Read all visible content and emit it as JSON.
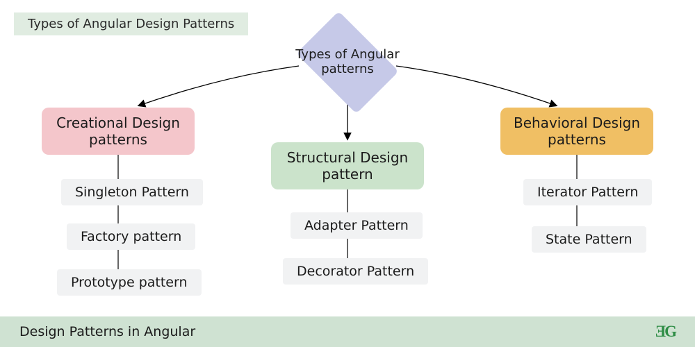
{
  "title": "Types of Angular Design Patterns",
  "root": "Types of\nAngular\npatterns",
  "categories": {
    "creational": "Creational Design\npatterns",
    "structural": "Structural Design\npattern",
    "behavioral": "Behavioral Design\npatterns"
  },
  "leaves": {
    "c1": "Singleton Pattern",
    "c2": "Factory pattern",
    "c3": "Prototype pattern",
    "s1": "Adapter Pattern",
    "s2": "Decorator Pattern",
    "b1": "Iterator Pattern",
    "b2": "State Pattern"
  },
  "footer": "Design Patterns in Angular",
  "logo": "ƎG",
  "colors": {
    "title_bg": "#e0ece1",
    "diamond": "#c6c9e8",
    "creational": "#f4c6cb",
    "structural": "#cbe3cb",
    "behavioral": "#f0bf64",
    "leaf": "#f1f2f3",
    "footer": "#cfe2d2",
    "logo": "#2f8d46"
  }
}
